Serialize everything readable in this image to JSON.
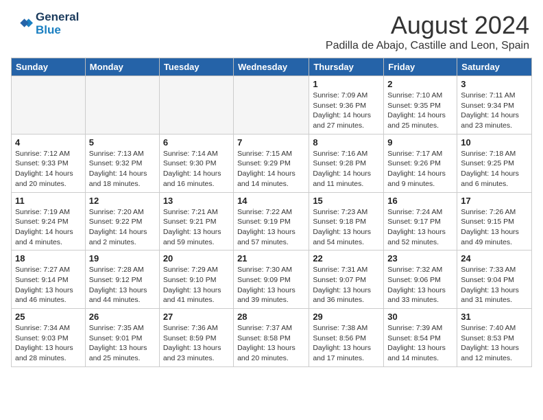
{
  "header": {
    "logo_line1": "General",
    "logo_line2": "Blue",
    "month": "August 2024",
    "location": "Padilla de Abajo, Castille and Leon, Spain"
  },
  "weekdays": [
    "Sunday",
    "Monday",
    "Tuesday",
    "Wednesday",
    "Thursday",
    "Friday",
    "Saturday"
  ],
  "weeks": [
    [
      {
        "day": "",
        "info": ""
      },
      {
        "day": "",
        "info": ""
      },
      {
        "day": "",
        "info": ""
      },
      {
        "day": "",
        "info": ""
      },
      {
        "day": "1",
        "info": "Sunrise: 7:09 AM\nSunset: 9:36 PM\nDaylight: 14 hours\nand 27 minutes."
      },
      {
        "day": "2",
        "info": "Sunrise: 7:10 AM\nSunset: 9:35 PM\nDaylight: 14 hours\nand 25 minutes."
      },
      {
        "day": "3",
        "info": "Sunrise: 7:11 AM\nSunset: 9:34 PM\nDaylight: 14 hours\nand 23 minutes."
      }
    ],
    [
      {
        "day": "4",
        "info": "Sunrise: 7:12 AM\nSunset: 9:33 PM\nDaylight: 14 hours\nand 20 minutes."
      },
      {
        "day": "5",
        "info": "Sunrise: 7:13 AM\nSunset: 9:32 PM\nDaylight: 14 hours\nand 18 minutes."
      },
      {
        "day": "6",
        "info": "Sunrise: 7:14 AM\nSunset: 9:30 PM\nDaylight: 14 hours\nand 16 minutes."
      },
      {
        "day": "7",
        "info": "Sunrise: 7:15 AM\nSunset: 9:29 PM\nDaylight: 14 hours\nand 14 minutes."
      },
      {
        "day": "8",
        "info": "Sunrise: 7:16 AM\nSunset: 9:28 PM\nDaylight: 14 hours\nand 11 minutes."
      },
      {
        "day": "9",
        "info": "Sunrise: 7:17 AM\nSunset: 9:26 PM\nDaylight: 14 hours\nand 9 minutes."
      },
      {
        "day": "10",
        "info": "Sunrise: 7:18 AM\nSunset: 9:25 PM\nDaylight: 14 hours\nand 6 minutes."
      }
    ],
    [
      {
        "day": "11",
        "info": "Sunrise: 7:19 AM\nSunset: 9:24 PM\nDaylight: 14 hours\nand 4 minutes."
      },
      {
        "day": "12",
        "info": "Sunrise: 7:20 AM\nSunset: 9:22 PM\nDaylight: 14 hours\nand 2 minutes."
      },
      {
        "day": "13",
        "info": "Sunrise: 7:21 AM\nSunset: 9:21 PM\nDaylight: 13 hours\nand 59 minutes."
      },
      {
        "day": "14",
        "info": "Sunrise: 7:22 AM\nSunset: 9:19 PM\nDaylight: 13 hours\nand 57 minutes."
      },
      {
        "day": "15",
        "info": "Sunrise: 7:23 AM\nSunset: 9:18 PM\nDaylight: 13 hours\nand 54 minutes."
      },
      {
        "day": "16",
        "info": "Sunrise: 7:24 AM\nSunset: 9:17 PM\nDaylight: 13 hours\nand 52 minutes."
      },
      {
        "day": "17",
        "info": "Sunrise: 7:26 AM\nSunset: 9:15 PM\nDaylight: 13 hours\nand 49 minutes."
      }
    ],
    [
      {
        "day": "18",
        "info": "Sunrise: 7:27 AM\nSunset: 9:14 PM\nDaylight: 13 hours\nand 46 minutes."
      },
      {
        "day": "19",
        "info": "Sunrise: 7:28 AM\nSunset: 9:12 PM\nDaylight: 13 hours\nand 44 minutes."
      },
      {
        "day": "20",
        "info": "Sunrise: 7:29 AM\nSunset: 9:10 PM\nDaylight: 13 hours\nand 41 minutes."
      },
      {
        "day": "21",
        "info": "Sunrise: 7:30 AM\nSunset: 9:09 PM\nDaylight: 13 hours\nand 39 minutes."
      },
      {
        "day": "22",
        "info": "Sunrise: 7:31 AM\nSunset: 9:07 PM\nDaylight: 13 hours\nand 36 minutes."
      },
      {
        "day": "23",
        "info": "Sunrise: 7:32 AM\nSunset: 9:06 PM\nDaylight: 13 hours\nand 33 minutes."
      },
      {
        "day": "24",
        "info": "Sunrise: 7:33 AM\nSunset: 9:04 PM\nDaylight: 13 hours\nand 31 minutes."
      }
    ],
    [
      {
        "day": "25",
        "info": "Sunrise: 7:34 AM\nSunset: 9:03 PM\nDaylight: 13 hours\nand 28 minutes."
      },
      {
        "day": "26",
        "info": "Sunrise: 7:35 AM\nSunset: 9:01 PM\nDaylight: 13 hours\nand 25 minutes."
      },
      {
        "day": "27",
        "info": "Sunrise: 7:36 AM\nSunset: 8:59 PM\nDaylight: 13 hours\nand 23 minutes."
      },
      {
        "day": "28",
        "info": "Sunrise: 7:37 AM\nSunset: 8:58 PM\nDaylight: 13 hours\nand 20 minutes."
      },
      {
        "day": "29",
        "info": "Sunrise: 7:38 AM\nSunset: 8:56 PM\nDaylight: 13 hours\nand 17 minutes."
      },
      {
        "day": "30",
        "info": "Sunrise: 7:39 AM\nSunset: 8:54 PM\nDaylight: 13 hours\nand 14 minutes."
      },
      {
        "day": "31",
        "info": "Sunrise: 7:40 AM\nSunset: 8:53 PM\nDaylight: 13 hours\nand 12 minutes."
      }
    ]
  ]
}
